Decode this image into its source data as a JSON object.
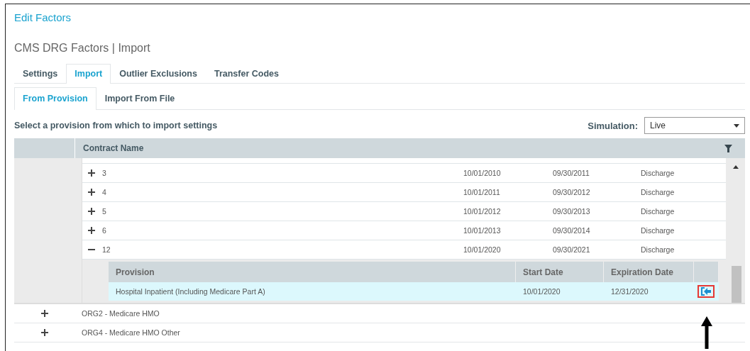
{
  "title": "Edit Factors",
  "subtitle": "CMS DRG Factors | Import",
  "tabs": [
    {
      "label": "Settings",
      "selected": false
    },
    {
      "label": "Import",
      "selected": true
    },
    {
      "label": "Outlier Exclusions",
      "selected": false
    },
    {
      "label": "Transfer Codes",
      "selected": false
    }
  ],
  "subtabs": [
    {
      "label": "From Provision",
      "selected": true
    },
    {
      "label": "Import From File",
      "selected": false
    }
  ],
  "instruction": "Select a provision from which to import settings",
  "simulation": {
    "label": "Simulation:",
    "value": "Live"
  },
  "table": {
    "columns": [
      "Contract Name"
    ],
    "contracts": [
      {
        "name": "3",
        "start": "10/01/2010",
        "end": "09/30/2011",
        "type": "Discharge",
        "expanded": false
      },
      {
        "name": "4",
        "start": "10/01/2011",
        "end": "09/30/2012",
        "type": "Discharge",
        "expanded": false
      },
      {
        "name": "5",
        "start": "10/01/2012",
        "end": "09/30/2013",
        "type": "Discharge",
        "expanded": false
      },
      {
        "name": "6",
        "start": "10/01/2013",
        "end": "09/30/2014",
        "type": "Discharge",
        "expanded": false
      },
      {
        "name": "12",
        "start": "10/01/2020",
        "end": "09/30/2021",
        "type": "Discharge",
        "expanded": true,
        "provisions": {
          "columns": [
            "Provision",
            "Start Date",
            "Expiration Date"
          ],
          "rows": [
            {
              "provision": "Hospital Inpatient (Including Medicare Part A)",
              "start": "10/01/2020",
              "end": "12/31/2020",
              "selected": true
            }
          ]
        }
      }
    ],
    "groups": [
      {
        "name": "ORG2 - Medicare HMO",
        "expanded": false
      },
      {
        "name": "ORG4 - Medicare HMO Other",
        "expanded": false
      }
    ]
  }
}
